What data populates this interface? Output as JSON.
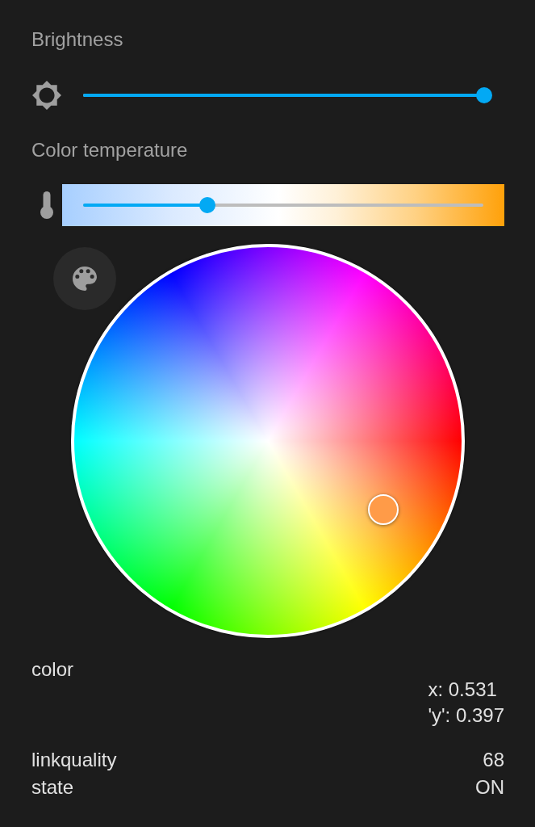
{
  "sliders": [
    {
      "kind": "brightness",
      "label": "Brightness",
      "level": 1
    },
    {
      "kind": "temperature",
      "label": "Color temperature",
      "level": 0.31
    }
  ],
  "attributes": [
    {
      "kind": "list",
      "name": "color",
      "values": [
        "x: 0.531",
        "'y': 0.397"
      ]
    },
    {
      "kind": "text",
      "name": "linkquality",
      "value": "68"
    },
    {
      "kind": "text",
      "name": "state",
      "value": "ON"
    }
  ]
}
